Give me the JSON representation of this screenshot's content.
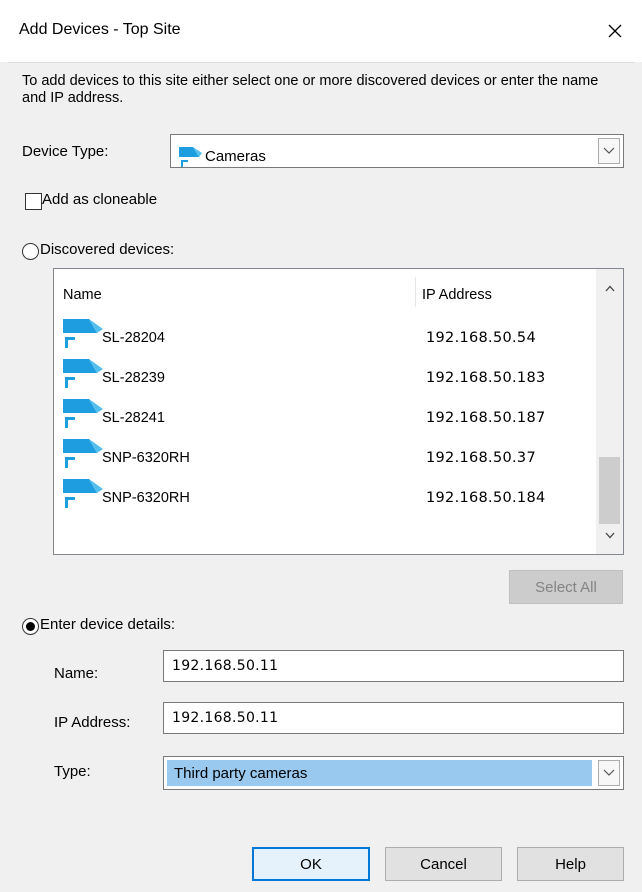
{
  "window": {
    "title": "Add Devices - Top Site",
    "close_icon": "close-icon"
  },
  "intro_text": "To add devices to this site either select one or more discovered devices or enter the name and IP address.",
  "device_type": {
    "label": "Device Type:",
    "value": "Cameras",
    "icon": "camera-icon"
  },
  "clone_checkbox": {
    "label": "Add as cloneable",
    "checked": false
  },
  "discovered": {
    "label": "Discovered devices:",
    "selected": false,
    "columns": [
      "Name",
      "IP Address"
    ],
    "rows": [
      {
        "name": "SL-28204",
        "ip": "192.168.50.54"
      },
      {
        "name": "SL-28239",
        "ip": "192.168.50.183"
      },
      {
        "name": "SL-28241",
        "ip": "192.168.50.187"
      },
      {
        "name": "SNP-6320RH",
        "ip": "192.168.50.37"
      },
      {
        "name": "SNP-6320RH",
        "ip": "192.168.50.184"
      }
    ],
    "select_all_label": "Select All"
  },
  "manual": {
    "label": "Enter device details:",
    "selected": true,
    "name_label": "Name:",
    "name_value": "192.168.50.11",
    "ip_label": "IP Address:",
    "ip_value": "192.168.50.11",
    "type_label": "Type:",
    "type_value": "Third party cameras"
  },
  "buttons": {
    "ok": "OK",
    "cancel": "Cancel",
    "help": "Help"
  },
  "colors": {
    "accent": "#0078d7",
    "selection": "#99c9ef",
    "camera_blue": "#1e9ee0"
  }
}
